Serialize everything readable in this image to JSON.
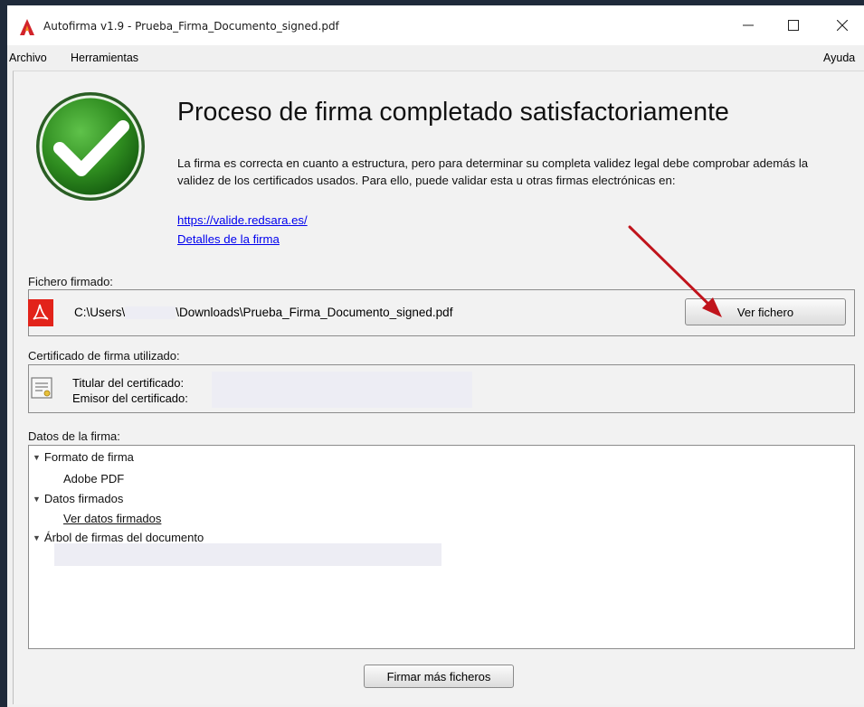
{
  "window": {
    "title": "Autofirma v1.9 - Prueba_Firma_Documento_signed.pdf",
    "controls": {
      "minimize": "—",
      "maximize": "☐",
      "close": "✕"
    }
  },
  "menu": {
    "archivo": "Archivo",
    "herramientas": "Herramientas",
    "ayuda": "Ayuda"
  },
  "result": {
    "heading": "Proceso de firma completado satisfactoriamente",
    "description": "La firma es correcta en cuanto a estructura, pero para determinar su completa validez legal debe comprobar además la validez de los certificados usados. Para ello, puede validar esta u otras firmas electrónicas en:",
    "link_valide": "https://valide.redsara.es/",
    "link_detalles": "Detalles de la firma"
  },
  "signed_file": {
    "label": "Fichero firmado:",
    "path_prefix": "C:\\Users\\",
    "path_suffix": "\\Downloads\\Prueba_Firma_Documento_signed.pdf",
    "view_button": "Ver fichero"
  },
  "certificate": {
    "label": "Certificado de firma utilizado:",
    "holder_label": "Titular del certificado:",
    "issuer_label": "Emisor del certificado:"
  },
  "signature_data": {
    "label": "Datos de la firma:",
    "format_header": "Formato de firma",
    "format_value": "Adobe PDF",
    "signed_data_header": "Datos firmados",
    "signed_data_link": "Ver datos firmados",
    "tree_header": "Árbol de firmas del documento"
  },
  "footer": {
    "sign_more_button": "Firmar más ficheros"
  },
  "colors": {
    "accent_link": "#0000ee",
    "check_green": "#2e8b1f",
    "pdf_red": "#e2231a",
    "arrow_red": "#c0141c"
  },
  "icons": [
    "autofirma-logo-icon",
    "success-check-icon",
    "pdf-file-icon",
    "certificate-icon",
    "expand-triangle-icon",
    "annotation-arrow"
  ]
}
